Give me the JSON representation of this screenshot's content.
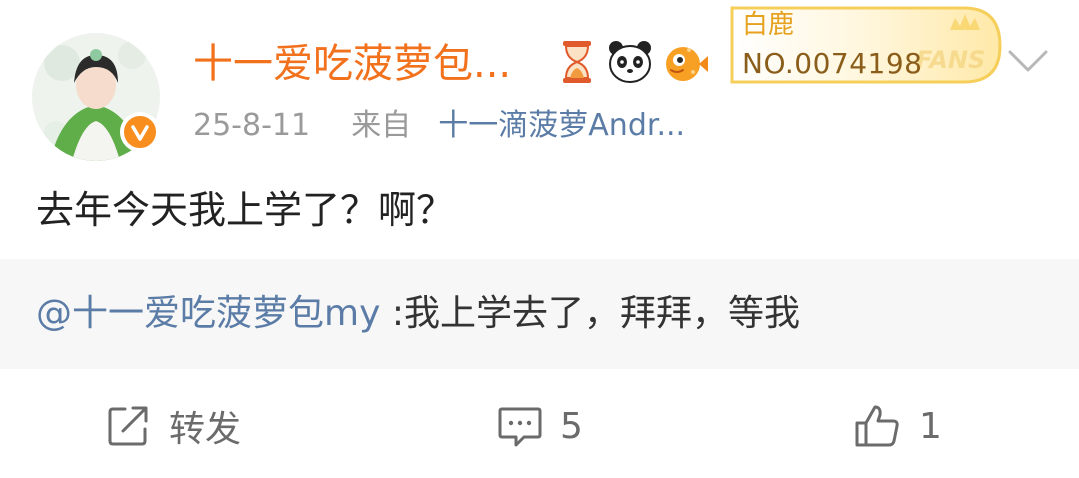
{
  "post": {
    "author": {
      "name": "十一爱吃菠萝包...",
      "emoji_badges": [
        "hourglass-icon",
        "panda-icon",
        "pufferfish-icon"
      ],
      "verified_icon": "verified-v-icon",
      "fan_badge": {
        "title": "白鹿",
        "number": "NO.0074198",
        "watermark": "FANS"
      }
    },
    "timestamp": "25-8-11",
    "source_prefix": "来自",
    "source": "十一滴菠萝Andr...",
    "text": "去年今天我上学了？啊？",
    "quoted": {
      "mention": "@十一爱吃菠萝包my",
      "text": " :我上学去了，拜拜，等我"
    }
  },
  "actions": {
    "repost_label": "转发",
    "comment_count": "5",
    "like_count": "1"
  },
  "colors": {
    "name": "#f2711c",
    "link": "#5b7ca6",
    "meta": "#9a9a9a",
    "quote_bg": "#f7f7f7"
  }
}
